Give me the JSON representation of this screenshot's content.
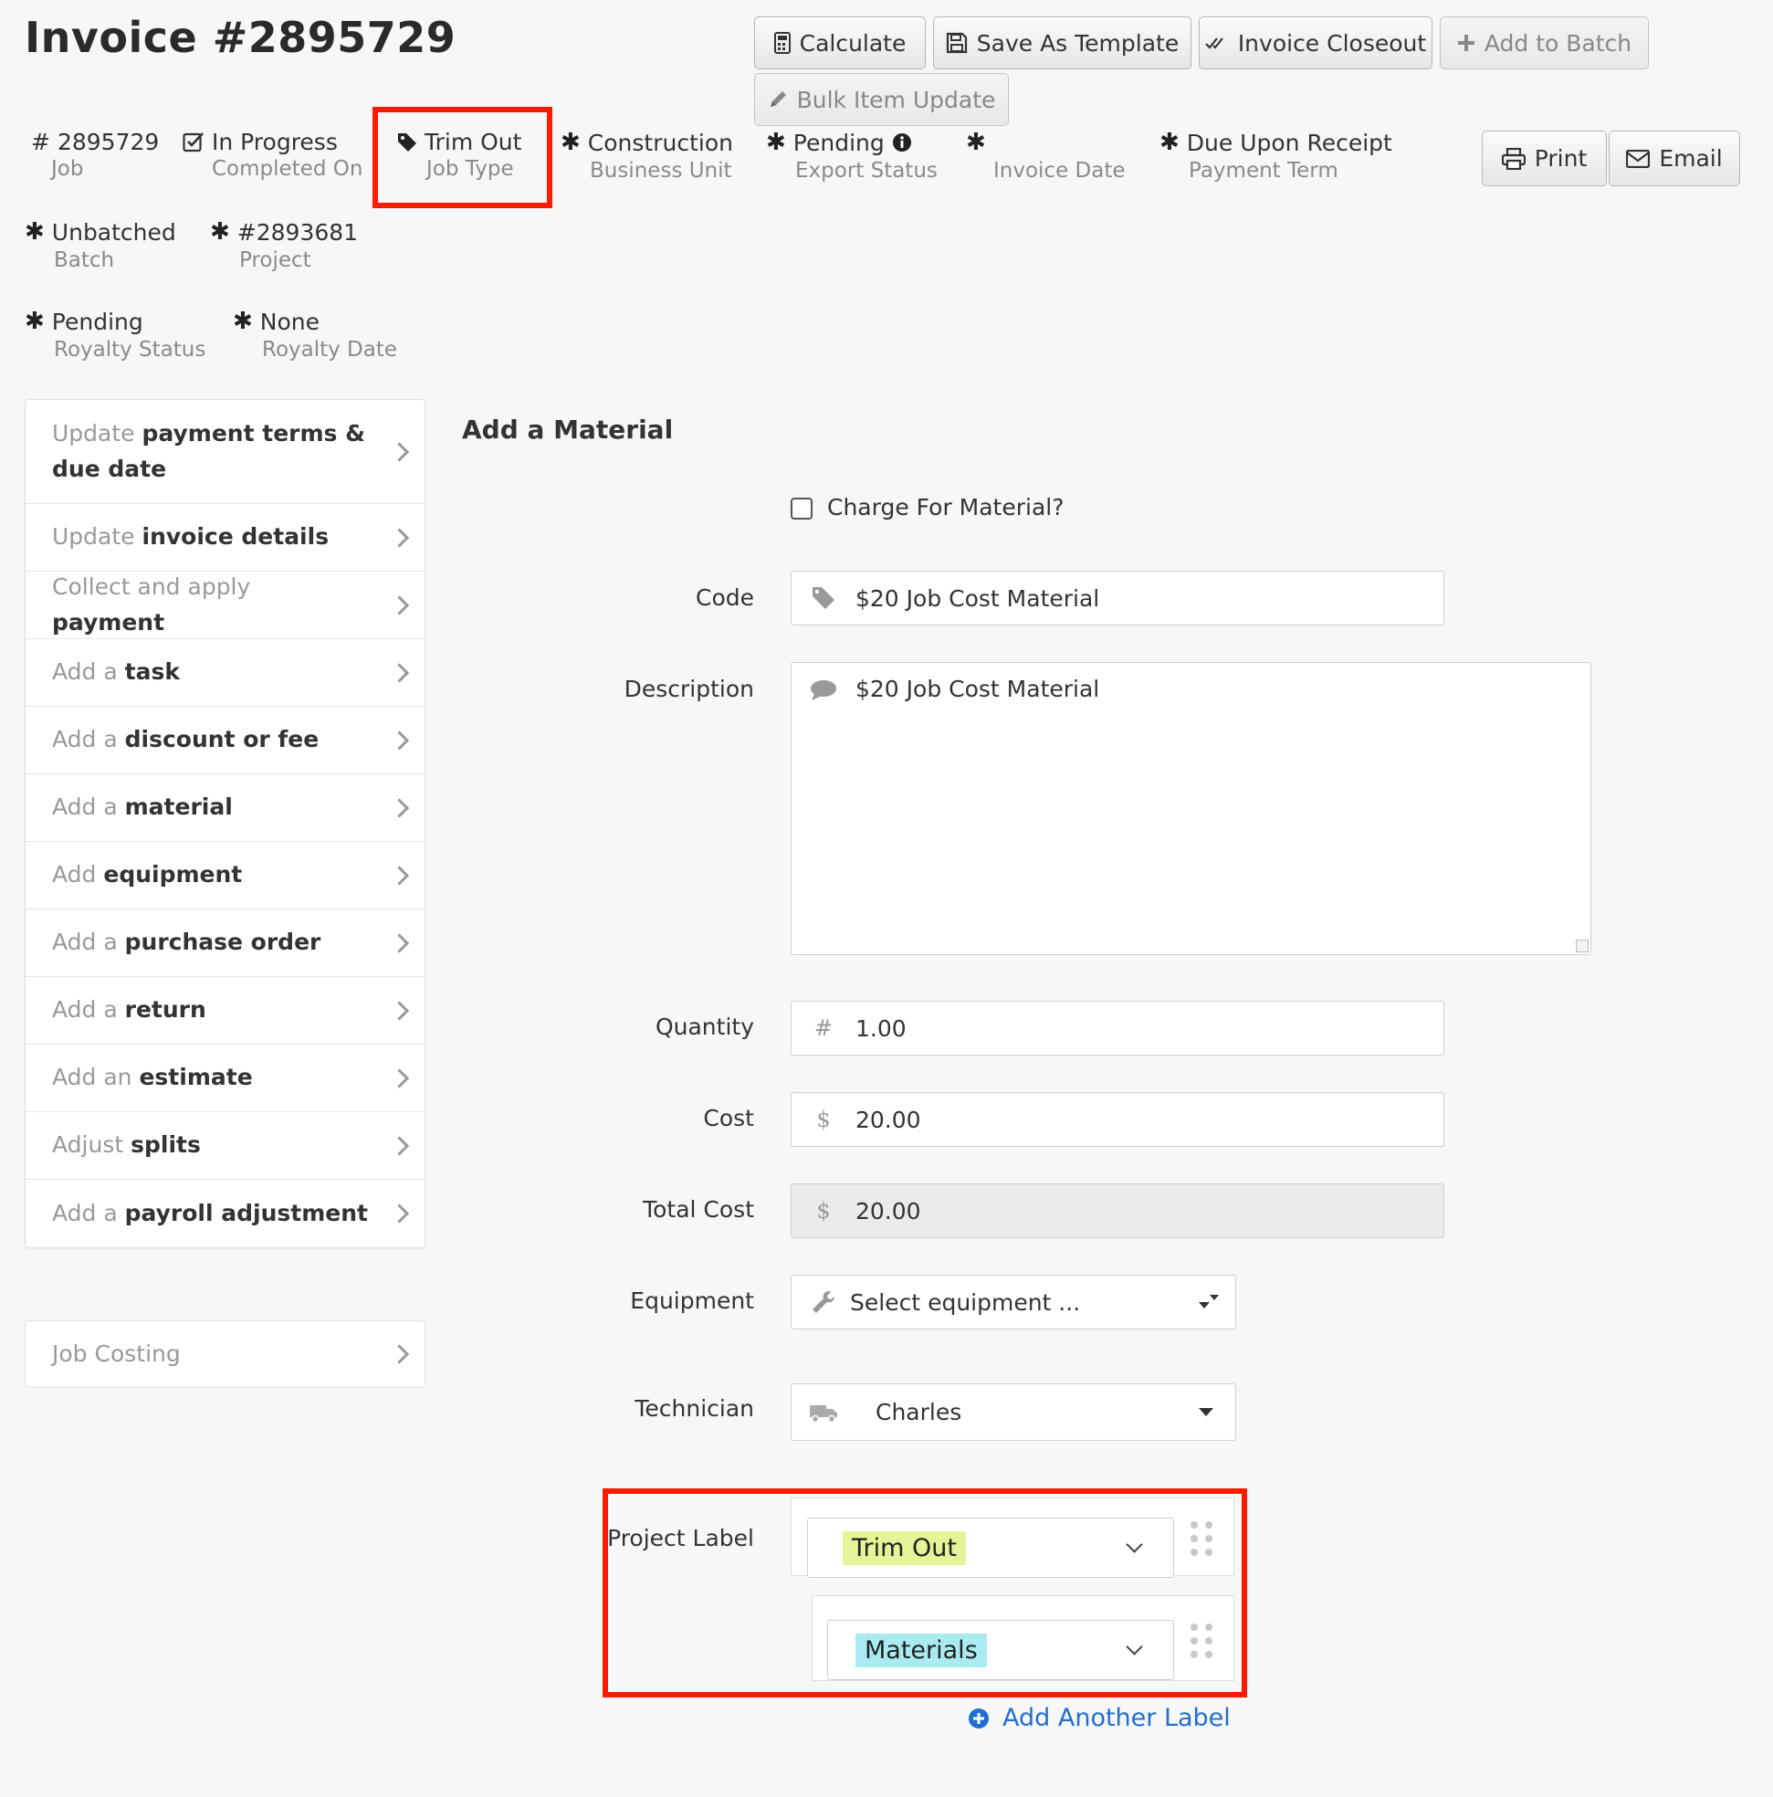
{
  "invoice": {
    "title": "Invoice #2895729"
  },
  "toolbar": {
    "calculate": "Calculate",
    "save_template": "Save As Template",
    "closeout": "Invoice Closeout",
    "add_batch": "Add to Batch",
    "bulk_update": "Bulk Item Update",
    "print": "Print",
    "email": "Email"
  },
  "meta": {
    "job": {
      "value": "2895729",
      "label": "Job"
    },
    "completed": {
      "value": "In Progress",
      "label": "Completed On"
    },
    "job_type": {
      "value": "Trim Out",
      "label": "Job Type"
    },
    "business_unit": {
      "value": "Construction",
      "label": "Business Unit"
    },
    "export_status": {
      "value": "Pending",
      "label": "Export Status"
    },
    "invoice_date": {
      "value": "",
      "label": "Invoice Date"
    },
    "payment_term": {
      "value": "Due Upon Receipt",
      "label": "Payment Term"
    },
    "batch": {
      "value": "Unbatched",
      "label": "Batch"
    },
    "project": {
      "value": "#2893681",
      "label": "Project"
    },
    "royalty_status": {
      "value": "Pending",
      "label": "Royalty Status"
    },
    "royalty_date": {
      "value": "None",
      "label": "Royalty Date"
    }
  },
  "menu": {
    "items": [
      {
        "pre": "Update ",
        "bold": "payment terms & due date"
      },
      {
        "pre": "Update ",
        "bold": "invoice details"
      },
      {
        "pre": "Collect and apply ",
        "bold": "payment"
      },
      {
        "pre": "Add a ",
        "bold": "task"
      },
      {
        "pre": "Add a ",
        "bold": "discount or fee"
      },
      {
        "pre": "Add a ",
        "bold": "material"
      },
      {
        "pre": "Add ",
        "bold": "equipment"
      },
      {
        "pre": "Add a ",
        "bold": "purchase order"
      },
      {
        "pre": "Add a ",
        "bold": "return"
      },
      {
        "pre": "Add an ",
        "bold": "estimate"
      },
      {
        "pre": "Adjust ",
        "bold": "splits"
      },
      {
        "pre": "Add a ",
        "bold": "payroll adjustment"
      }
    ],
    "job_costing": "Job Costing"
  },
  "form": {
    "title": "Add a Material",
    "charge_label": "Charge For Material?",
    "code_label": "Code",
    "code_value": "$20 Job Cost Material",
    "desc_label": "Description",
    "desc_value": "$20 Job Cost Material",
    "qty_label": "Quantity",
    "qty_value": "1.00",
    "cost_label": "Cost",
    "cost_value": "20.00",
    "total_label": "Total Cost",
    "total_value": "20.00",
    "equip_label": "Equipment",
    "equip_placeholder": "Select equipment ...",
    "tech_label": "Technician",
    "tech_value": "Charles",
    "project_label": "Project Label",
    "labels": [
      {
        "text": "Trim Out",
        "color": "#e4f598"
      },
      {
        "text": "Materials",
        "color": "#a8ecf2"
      }
    ],
    "add_label": "Add Another Label"
  },
  "colors": {
    "highlight": "#ff1a00",
    "link": "#1f6fd0"
  }
}
